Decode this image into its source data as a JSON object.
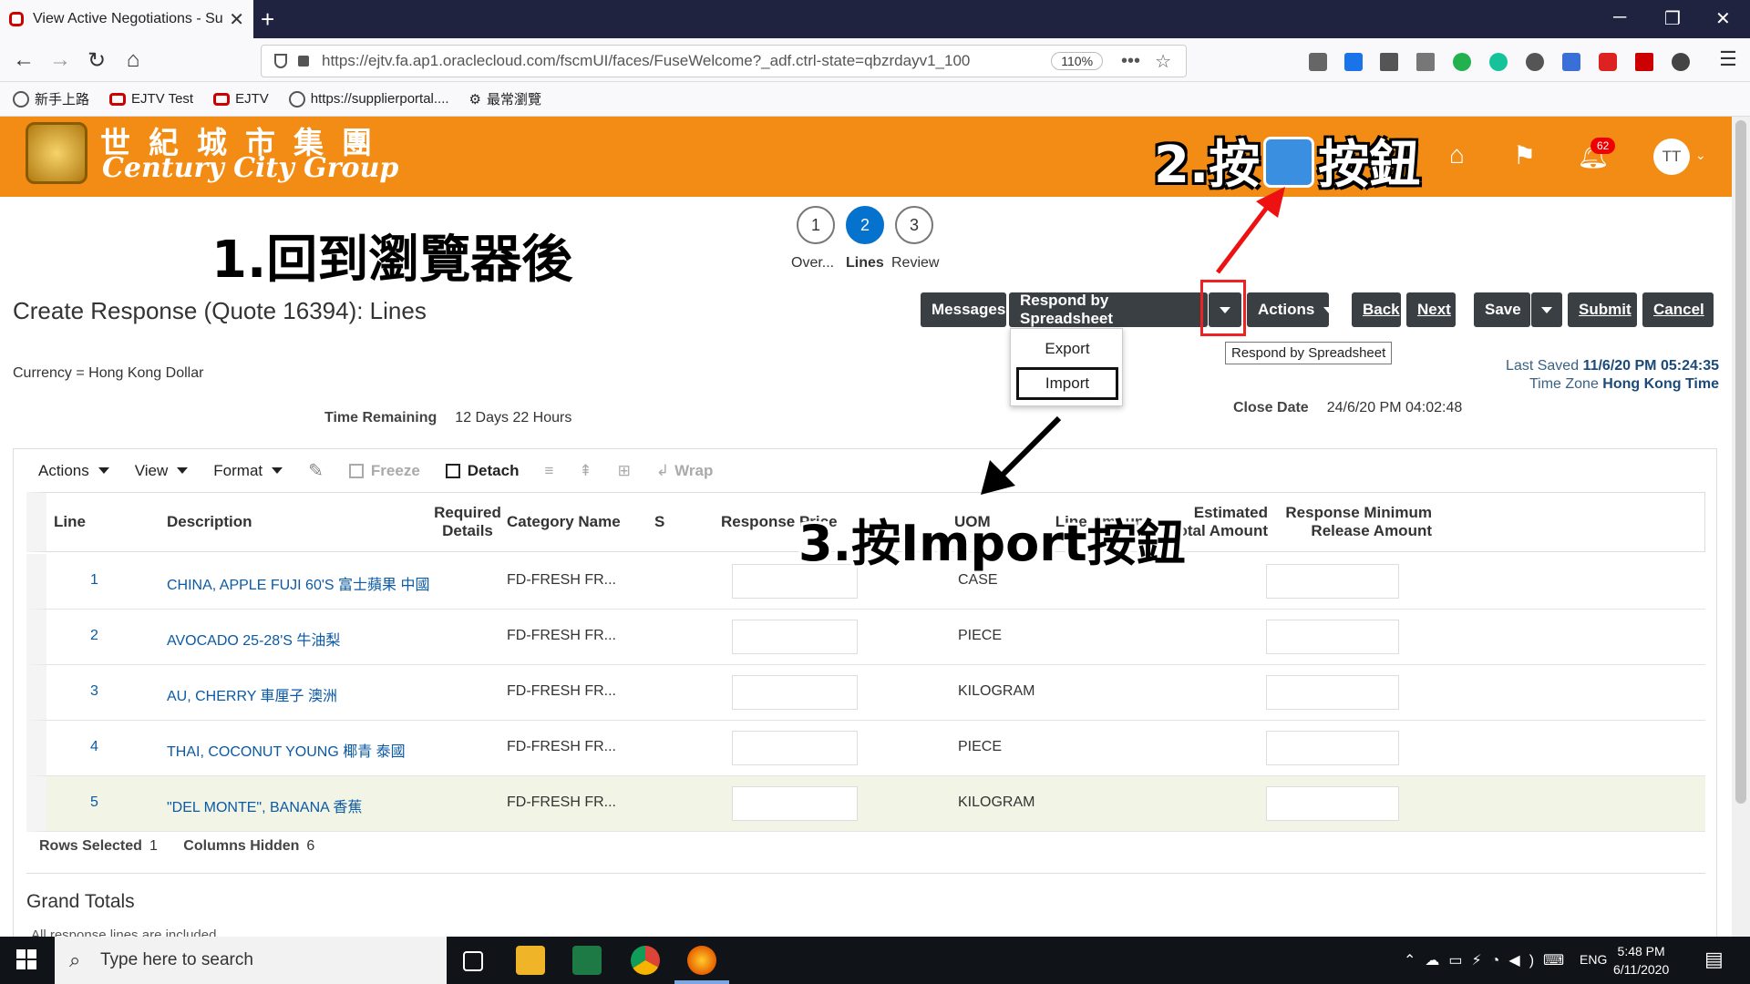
{
  "browser": {
    "tab_title": "View Active Negotiations - Sup",
    "url": "https://ejtv.fa.ap1.oraclecloud.com/fscmUI/faces/FuseWelcome?_adf.ctrl-state=qbzrdayv1_100",
    "zoom": "110%"
  },
  "bookmarks": [
    "新手上路",
    "EJTV Test",
    "EJTV",
    "https://supplierportal....",
    "最常瀏覽"
  ],
  "header": {
    "logo_cn": "世紀城市集團",
    "logo_en": "Century City Group",
    "notif_count": "62",
    "avatar": "TT"
  },
  "annotations": {
    "a1": "1.回到瀏覽器後",
    "a2_prefix": "2.按",
    "a2_suffix": "按鈕",
    "a3": "3.按Import按鈕"
  },
  "train": [
    {
      "num": "1",
      "label": "Over..."
    },
    {
      "num": "2",
      "label": "Lines"
    },
    {
      "num": "3",
      "label": "Review"
    }
  ],
  "page": {
    "title": "Create Response (Quote 16394): Lines",
    "currency": "Currency = Hong Kong Dollar",
    "time_remaining_label": "Time Remaining",
    "time_remaining": "12 Days 22 Hours",
    "close_date_label": "Close Date",
    "close_date": "24/6/20 PM 04:02:48",
    "last_saved_label": "Last Saved",
    "last_saved": "11/6/20 PM 05:24:35",
    "tz_label": "Time Zone",
    "tz": "Hong Kong Time"
  },
  "buttons": {
    "messages": "Messages",
    "respond": "Respond by Spreadsheet",
    "actions": "Actions",
    "back": "Back",
    "next": "Next",
    "save": "Save",
    "submit": "Submit",
    "cancel": "Cancel"
  },
  "menu": {
    "export": "Export",
    "import": "Import"
  },
  "tooltip": "Respond by Spreadsheet",
  "toolbar": {
    "actions": "Actions",
    "view": "View",
    "format": "Format",
    "freeze": "Freeze",
    "detach": "Detach",
    "wrap": "Wrap"
  },
  "table": {
    "headers": {
      "line": "Line",
      "description": "Description",
      "required_details": "Required Details",
      "category": "Category Name",
      "s": "S",
      "price": "Response Price",
      "uom": "UOM",
      "line_amount": "Line Amount",
      "est_total": "Estimated Total Amount",
      "min_release": "Response Minimum Release Amount"
    },
    "rows": [
      {
        "line": "1",
        "description": "CHINA, APPLE FUJI 60'S 富士蘋果 中國",
        "category": "FD-FRESH FR...",
        "uom": "CASE"
      },
      {
        "line": "2",
        "description": "AVOCADO 25-28'S 牛油梨",
        "category": "FD-FRESH FR...",
        "uom": "PIECE"
      },
      {
        "line": "3",
        "description": "AU, CHERRY 車厘子 澳洲",
        "category": "FD-FRESH FR...",
        "uom": "KILOGRAM"
      },
      {
        "line": "4",
        "description": "THAI, COCONUT YOUNG 椰青 泰國",
        "category": "FD-FRESH FR...",
        "uom": "PIECE"
      },
      {
        "line": "5",
        "description": "\"DEL MONTE\", BANANA 香蕉",
        "category": "FD-FRESH FR...",
        "uom": "KILOGRAM"
      }
    ],
    "rows_selected_label": "Rows Selected",
    "rows_selected": "1",
    "cols_hidden_label": "Columns Hidden",
    "cols_hidden": "6"
  },
  "grand_totals": {
    "title": "Grand Totals",
    "sub": "All response lines are included"
  },
  "taskbar": {
    "search": "Type here to search",
    "lang": "ENG",
    "time": "5:48 PM",
    "date": "6/11/2020"
  }
}
